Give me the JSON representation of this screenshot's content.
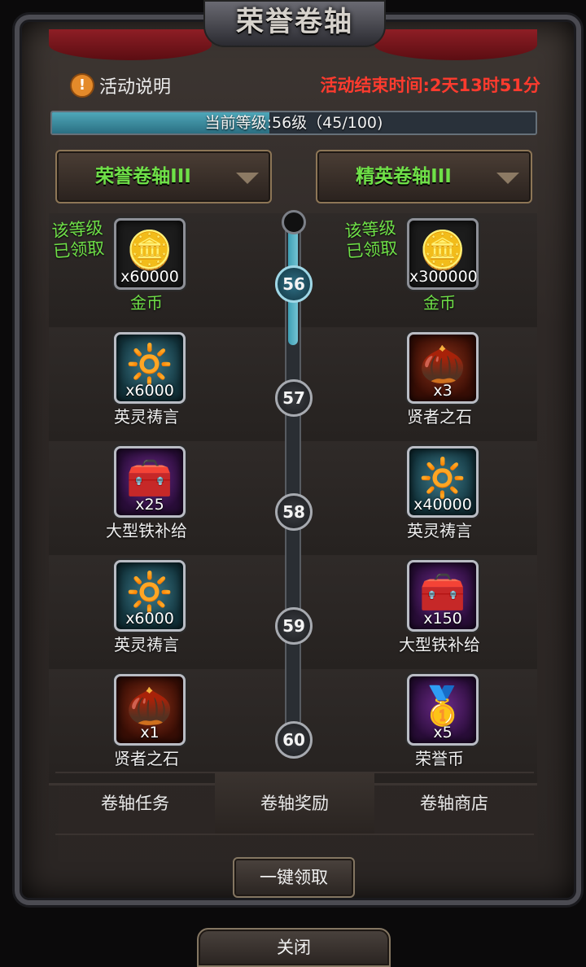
{
  "window": {
    "title": "荣誉卷轴"
  },
  "header": {
    "info_label": "活动说明",
    "info_icon": "warning-icon",
    "countdown": "活动结束时间:2天13时51分"
  },
  "progress": {
    "label": "当前等级:56级（45/100)",
    "current_level": 56,
    "exp": 45,
    "exp_max": 100,
    "fraction": 0.45
  },
  "tracks": {
    "left": {
      "label": "荣誉卷轴III"
    },
    "right": {
      "label": "精英卷轴III"
    }
  },
  "claimed_text": "该等级\n已领取",
  "levels": [
    {
      "level": "56",
      "left": {
        "qty": "x60000",
        "name": "金币",
        "icon": "gold-coin-icon",
        "claimed": true
      },
      "right": {
        "qty": "x300000",
        "name": "金币",
        "icon": "gold-coin-icon",
        "claimed": true
      }
    },
    {
      "level": "57",
      "left": {
        "qty": "x6000",
        "name": "英灵祷言",
        "icon": "spirit-orb-icon",
        "claimed": false
      },
      "right": {
        "qty": "x3",
        "name": "贤者之石",
        "icon": "sage-stone-icon",
        "claimed": false
      }
    },
    {
      "level": "58",
      "left": {
        "qty": "x25",
        "name": "大型铁补给",
        "icon": "iron-chest-icon",
        "claimed": false
      },
      "right": {
        "qty": "x40000",
        "name": "英灵祷言",
        "icon": "spirit-orb-icon",
        "claimed": false
      }
    },
    {
      "level": "59",
      "left": {
        "qty": "x6000",
        "name": "英灵祷言",
        "icon": "spirit-orb-icon",
        "claimed": false
      },
      "right": {
        "qty": "x150",
        "name": "大型铁补给",
        "icon": "iron-chest-icon",
        "claimed": false
      }
    },
    {
      "level": "60",
      "left": {
        "qty": "x1",
        "name": "贤者之石",
        "icon": "sage-stone-icon",
        "claimed": false
      },
      "right": {
        "qty": "x5",
        "name": "荣誉币",
        "icon": "honor-coin-icon",
        "claimed": false
      }
    }
  ],
  "tabs": [
    {
      "label": "卷轴任务"
    },
    {
      "label": "卷轴奖励",
      "active": true
    },
    {
      "label": "卷轴商店"
    }
  ],
  "buttons": {
    "claim_all": "一键领取",
    "close": "关闭"
  },
  "colors": {
    "accent_green": "#6fe048",
    "timer_red": "#ff3b2e",
    "progress_teal": "#4ea7b9"
  }
}
